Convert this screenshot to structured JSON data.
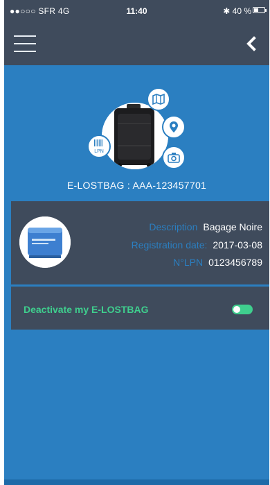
{
  "status_bar": {
    "carrier": "●●○○○ SFR  4G",
    "time": "11:40",
    "battery": "✱ 40 %"
  },
  "nav": {
    "menu_icon": "hamburger-menu-icon",
    "back_icon": "chevron-left-icon"
  },
  "bag": {
    "title": "E-LOSTBAG : AAA-123457701",
    "badge_icons": [
      "map-icon",
      "location-pin-icon",
      "camera-icon",
      "lpn-barcode-icon"
    ],
    "lpn_badge_text": "LPN"
  },
  "details": {
    "description_label": "Description",
    "description_value": "Bagage Noire",
    "registration_label": "Registration date:",
    "registration_value": "2017-03-08",
    "lpn_label": "N°LPN",
    "lpn_value": "0123456789"
  },
  "deactivate": {
    "label": "Deactivate my E-LOSTBAG",
    "toggle_on": true
  },
  "colors": {
    "background": "#2b7fc1",
    "bar": "#3f4b5c",
    "accent_green": "#3fcf8e"
  }
}
